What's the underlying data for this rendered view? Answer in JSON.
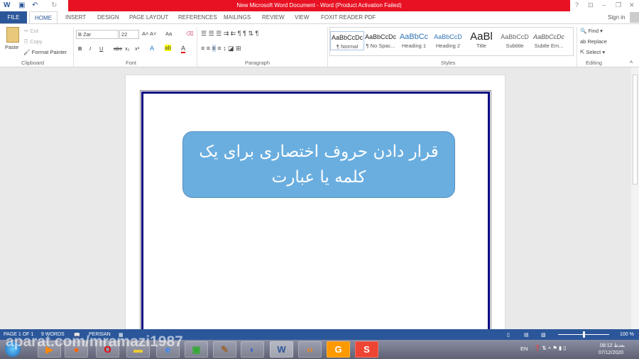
{
  "title": "New Microsoft Word Document -  Word (Product Activation Failed)",
  "window_controls": [
    "?",
    "⊡",
    "–",
    "❐",
    "✕"
  ],
  "tabs": [
    "FILE",
    "HOME",
    "INSERT",
    "DESIGN",
    "PAGE LAYOUT",
    "REFERENCES",
    "MAILINGS",
    "REVIEW",
    "VIEW",
    "FOXIT READER PDF"
  ],
  "sign_in": "Sign in",
  "clipboard": {
    "paste": "Paste",
    "cut": "Cut",
    "copy": "Copy",
    "format_painter": "Format Painter",
    "label": "Clipboard"
  },
  "font": {
    "name": "B Zar",
    "size": "22",
    "label": "Font",
    "case": "Aa",
    "bold": "B",
    "italic": "I",
    "underline": "U",
    "strike": "abc",
    "sub": "x₂",
    "sup": "x²"
  },
  "paragraph": {
    "label": "Paragraph"
  },
  "styles": {
    "label": "Styles",
    "items": [
      {
        "preview": "AaBbCcDc",
        "name": "¶ Normal"
      },
      {
        "preview": "AaBbCcDc",
        "name": "¶ No Spac..."
      },
      {
        "preview": "AaBbCc",
        "name": "Heading 1"
      },
      {
        "preview": "AaBbCcD",
        "name": "Heading 2"
      },
      {
        "preview": "AaBl",
        "name": "Title"
      },
      {
        "preview": "AaBbCcD",
        "name": "Subtitle"
      },
      {
        "preview": "AaBbCcDc",
        "name": "Subtle Em..."
      }
    ]
  },
  "editing": {
    "label": "Editing",
    "find": "Find",
    "replace": "Replace",
    "select": "Select"
  },
  "document": {
    "shape_text": "قرار دادن حروف اختصاری برای یک کلمه یا عبارت"
  },
  "status": {
    "page": "PAGE 1 OF 1",
    "words": "9 WORDS",
    "language": "PERSIAN",
    "zoom": "100 %",
    "zoom_percent": 100
  },
  "taskbar": {
    "lang": "EN",
    "time": "08:12 بعدظ",
    "date": "07/12/2020",
    "watermark": "aparat.com/mramazi1987"
  },
  "colors": {
    "accent": "#2b579a",
    "title_red": "#e81123",
    "shape": "#6aaee0",
    "border": "#00007f"
  }
}
